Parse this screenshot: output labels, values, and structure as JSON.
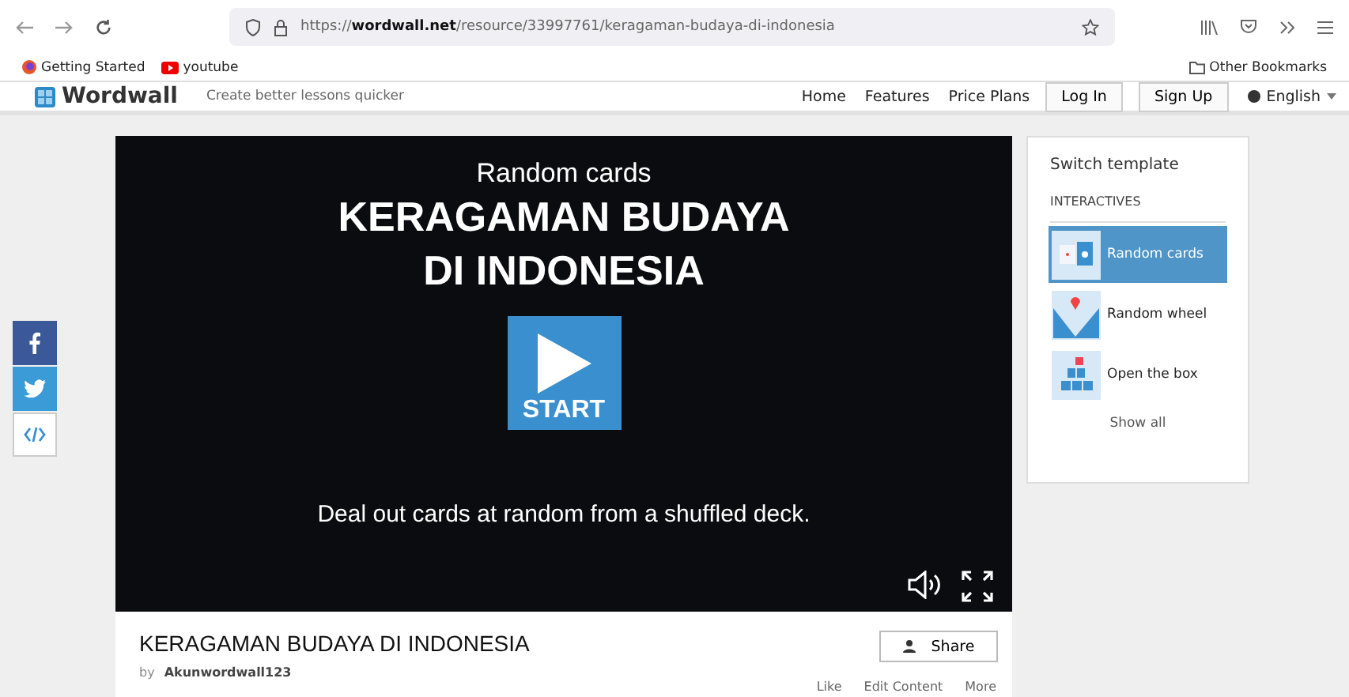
{
  "browser": {
    "url_prefix": "https://",
    "url_domain": "wordwall.net",
    "url_path": "/resource/33997761/keragaman-budaya-di-indonesia",
    "bookmarks": [
      "Getting Started",
      "youtube"
    ],
    "other_bookmarks": "Other Bookmarks"
  },
  "header": {
    "logo": "Wordwall",
    "tagline": "Create better lessons quicker",
    "nav": [
      "Home",
      "Features",
      "Price Plans"
    ],
    "buttons": [
      "Log In",
      "Sign Up"
    ],
    "language": "English"
  },
  "social": [
    {
      "kind": "facebook"
    },
    {
      "kind": "twitter"
    },
    {
      "kind": "embed"
    }
  ],
  "player": {
    "template": "Random cards",
    "title_lines": [
      "KERAGAMAN BUDAYA",
      "DI INDONESIA"
    ],
    "start": "START",
    "description": "Deal out cards at random from a shuffled deck."
  },
  "sidebar": {
    "title": "Switch template",
    "section": "INTERACTIVES",
    "items": [
      {
        "label": "Random cards",
        "kind": "cards",
        "selected": true
      },
      {
        "label": "Random wheel",
        "kind": "wheel",
        "selected": false
      },
      {
        "label": "Open the box",
        "kind": "box",
        "selected": false
      }
    ],
    "show_all": "Show all"
  },
  "activity": {
    "title": "KERAGAMAN BUDAYA DI INDONESIA",
    "by": "by",
    "author": "Akunwordwall123",
    "share": "Share",
    "actions": [
      "Like",
      "Edit Content",
      "More"
    ]
  }
}
